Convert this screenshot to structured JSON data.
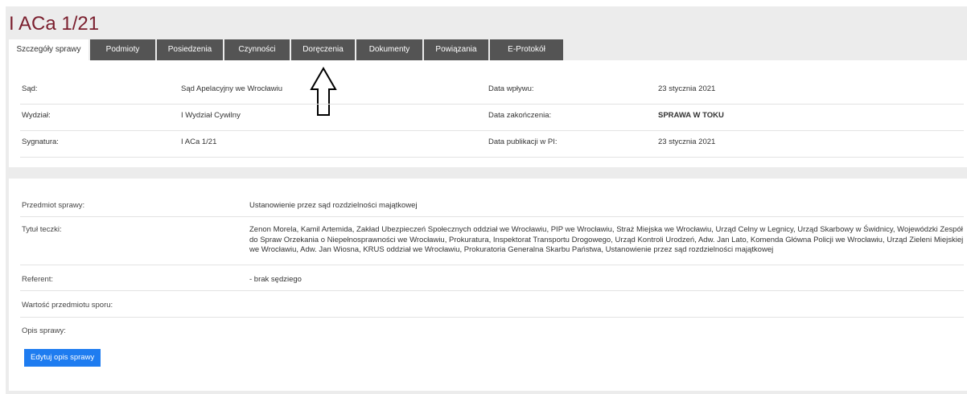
{
  "case": {
    "title": "I ACa 1/21"
  },
  "tabs": [
    {
      "label": "Szczegóły sprawy",
      "active": true
    },
    {
      "label": "Podmioty"
    },
    {
      "label": "Posiedzenia"
    },
    {
      "label": "Czynności"
    },
    {
      "label": "Doręczenia"
    },
    {
      "label": "Dokumenty"
    },
    {
      "label": "Powiązania"
    },
    {
      "label": "E-Protokół"
    }
  ],
  "info": {
    "court_label": "Sąd:",
    "court_value": "Sąd Apelacyjny we Wrocławiu",
    "received_label": "Data wpływu:",
    "received_value": "23 stycznia 2021",
    "division_label": "Wydział:",
    "division_value": "I Wydział Cywilny",
    "end_label": "Data zakończenia:",
    "end_value": "SPRAWA W TOKU",
    "signature_label": "Sygnatura:",
    "signature_value": "I ACa 1/21",
    "published_label": "Data publikacji w PI:",
    "published_value": "23 stycznia 2021"
  },
  "annotation": {
    "icon": "up-arrow-icon"
  },
  "details": {
    "subject_label": "Przedmiot sprawy:",
    "subject_value": "Ustanowienie przez sąd rozdzielności majątkowej",
    "file_title_label": "Tytuł teczki:",
    "file_title_value": "Zenon Morela, Kamil Artemida, Zakład Ubezpieczeń Społecznych oddział we Wrocławiu, PIP we Wrocławiu, Straż Miejska we Wrocławiu, Urząd Celny w Legnicy, Urząd Skarbowy w Świdnicy, Wojewódzki Zespół do Spraw Orzekania o Niepełnosprawności we Wrocławiu, Prokuratura, Inspektorat Transportu Drogowego, Urząd Kontroli Urodzeń, Adw. Jan Lato, Komenda Główna Policji we Wrocławiu, Urząd Zieleni Miejskiej we Wrocławiu, Adw. Jan Wiosna, KRUS oddział we Wrocławiu, Prokuratoria Generalna Skarbu Państwa, Ustanowienie przez sąd rozdzielności majątkowej",
    "referent_label": "Referent:",
    "referent_value": "- brak sędziego",
    "dispute_value_label": "Wartość przedmiotu sporu:",
    "description_label": "Opis sprawy:",
    "edit_button": "Edytuj opis sprawy"
  }
}
